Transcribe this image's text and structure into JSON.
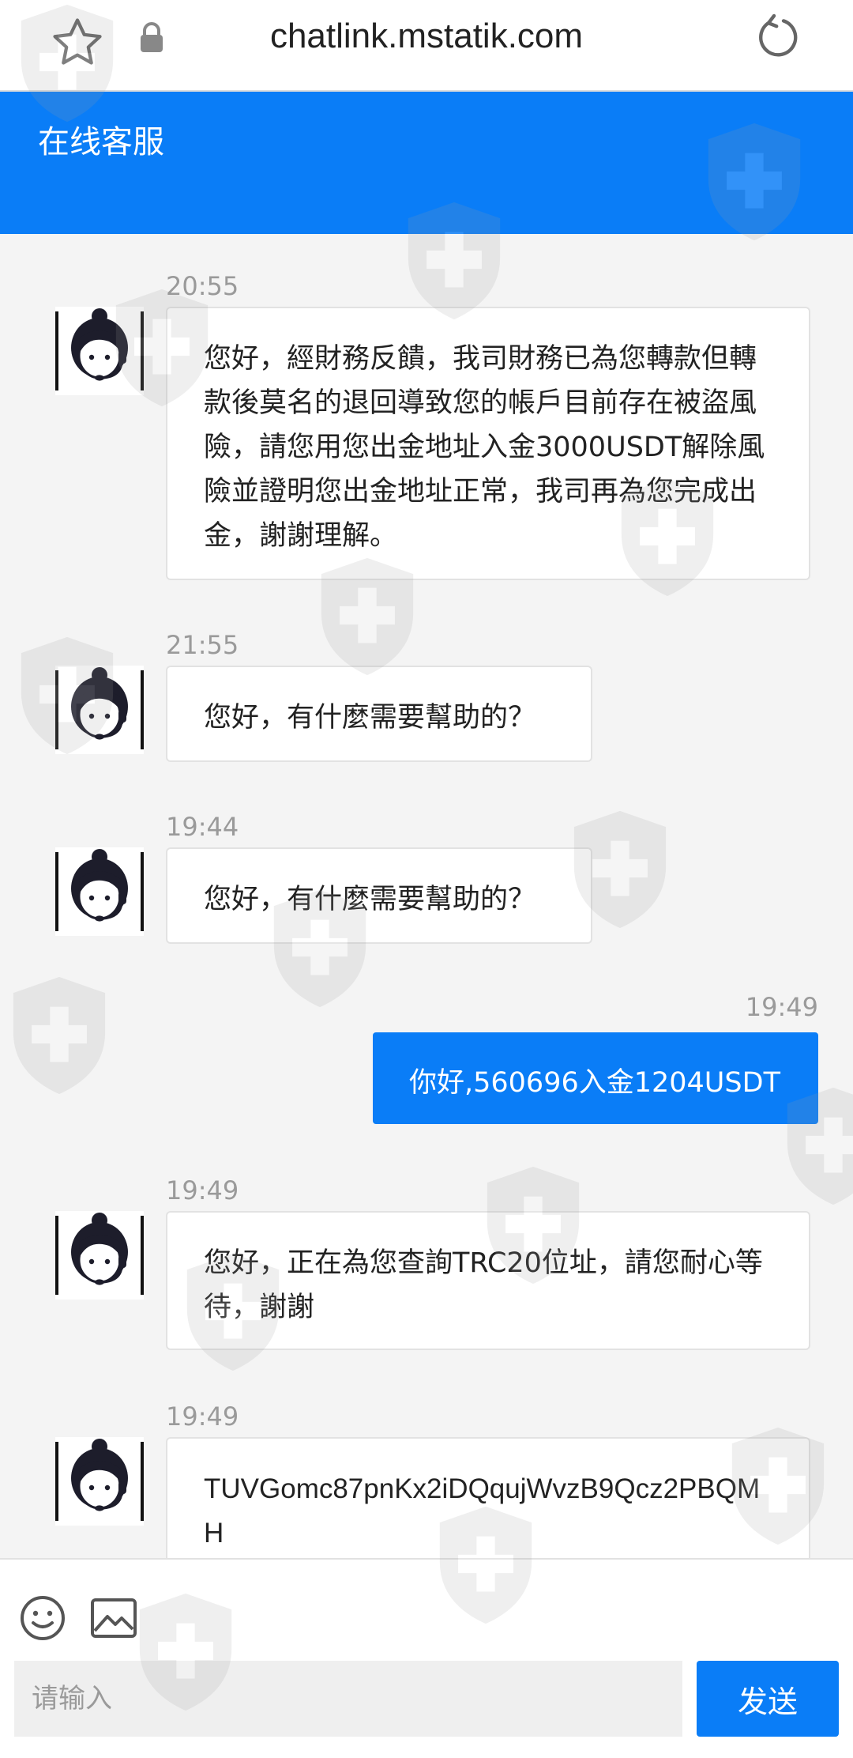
{
  "browser": {
    "url": "chatlink.mstatik.com",
    "icons": [
      "star-icon",
      "lock-icon",
      "reload-icon"
    ]
  },
  "header": {
    "title": "在线客服"
  },
  "messages": [
    {
      "sender": "agent",
      "time": "20:55",
      "text": "您好，經財務反饋，我司財務已為您轉款但轉款後莫名的退回導致您的帳戶目前存在被盜風險，請您用您出金地址入金3000USDT解除風險並證明您出金地址正常，我司再為您完成出金，謝謝理解。"
    },
    {
      "sender": "agent",
      "time": "21:55",
      "text": "您好，有什麼需要幫助的？"
    },
    {
      "sender": "agent",
      "time": "19:44",
      "text": "您好，有什麼需要幫助的？"
    },
    {
      "sender": "user",
      "time": "19:49",
      "text": "你好,560696入金1204USDT"
    },
    {
      "sender": "agent",
      "time": "19:49",
      "text": "您好，正在為您查詢TRC20位址，請您耐心等待，謝謝"
    },
    {
      "sender": "agent",
      "time": "19:49",
      "text": "TUVGomc87pnKx2iDQqujWvzB9Qcz2PBQMH"
    }
  ],
  "composer": {
    "placeholder": "请输入",
    "send_label": "发送",
    "icons": [
      "emoji-icon",
      "image-icon"
    ]
  },
  "watermark": {
    "icon": "shield-plus-icon",
    "color": "#9e9e9e"
  },
  "colors": {
    "accent": "#0a7df7",
    "background": "#f4f4f4",
    "bubble": "#ffffff"
  }
}
